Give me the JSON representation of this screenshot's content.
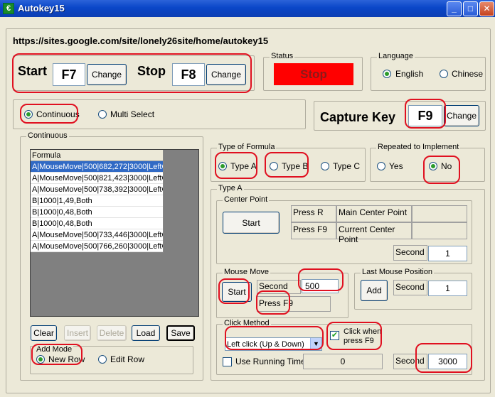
{
  "window": {
    "title": "Autokey15"
  },
  "url_text": "https://sites.google.com/site/lonely26site/home/autokey15",
  "hotkeys": {
    "start_label": "Start",
    "start_key": "F7",
    "start_change": "Change",
    "stop_label": "Stop",
    "stop_key": "F8",
    "stop_change": "Change"
  },
  "status": {
    "group_label": "Status",
    "value": "Stop",
    "color": "#ff0000"
  },
  "language": {
    "group_label": "Language",
    "english": "English",
    "chinese": "Chinese",
    "selected": "English"
  },
  "mode": {
    "continuous": "Continuous",
    "multi_select": "Multi Select",
    "selected": "Continuous"
  },
  "capture": {
    "label": "Capture Key",
    "key": "F9",
    "change": "Change"
  },
  "continuous_group": {
    "label": "Continuous",
    "table_header": "Formula",
    "rows": [
      "A|MouseMove|500|682,272|3000|LeftC",
      "A|MouseMove|500|821,423|3000|LeftC",
      "A|MouseMove|500|738,392|3000|LeftC",
      "B|1000|1,49,Both",
      "B|1000|0,48,Both",
      "B|1000|0,48,Both",
      "A|MouseMove|500|733,446|3000|LeftC",
      "A|MouseMove|500|766,260|3000|LeftC"
    ],
    "selected_row": 1,
    "buttons": {
      "clear": "Clear",
      "insert": "Insert",
      "delete": "Delete",
      "load": "Load",
      "save": "Save"
    },
    "add_mode": {
      "label": "Add Mode",
      "new_row": "New Row",
      "edit_row": "Edit Row",
      "selected": "New Row"
    }
  },
  "formula_type": {
    "label": "Type of Formula",
    "a": "Type A",
    "b": "Type B",
    "c": "Type C",
    "selected": "Type A"
  },
  "repeat": {
    "label": "Repeated to Implement",
    "yes": "Yes",
    "no": "No",
    "selected": "No"
  },
  "type_a": {
    "label": "Type A",
    "center_point": {
      "label": "Center Point",
      "start": "Start",
      "press_r": "Press R",
      "main_center": "Main Center Point",
      "press_f9": "Press F9",
      "current_center": "Current Center Point",
      "second_label": "Second",
      "second_value": "1"
    },
    "mouse_move": {
      "label": "Mouse Move",
      "start": "Start",
      "second_label": "Second",
      "second_value": "500",
      "press_f9": "Press F9"
    },
    "last_mouse": {
      "label": "Last Mouse Position",
      "add": "Add",
      "second_label": "Second",
      "second_value": "1"
    },
    "click_method": {
      "label": "Click Method",
      "select_value": "Left click (Up & Down)",
      "click_when": "Click when press F9",
      "click_when_checked": true,
      "use_running_time": "Use Running Time",
      "running_time_value": "0",
      "second_label": "Second",
      "second_value": "3000"
    }
  }
}
